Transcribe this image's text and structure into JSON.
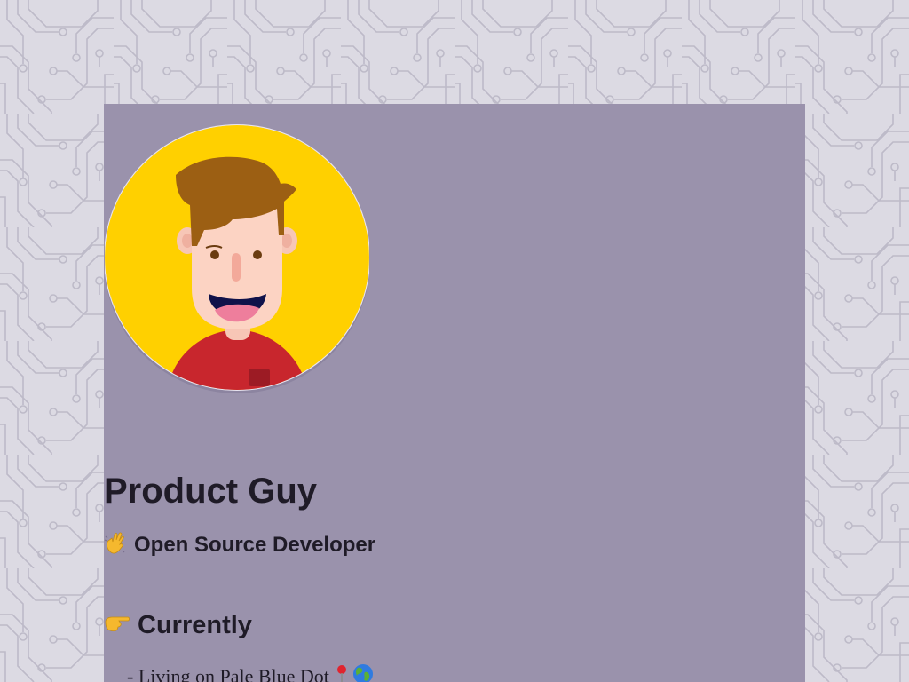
{
  "profile": {
    "name": "Product Guy",
    "tagline_emoji": "wave-icon",
    "tagline": "Open Source Developer"
  },
  "currently": {
    "heading_emoji": "pointing-hand-icon",
    "heading": "Currently",
    "items": [
      {
        "text": "- Living on Pale Blue Dot",
        "icons": [
          "pin-icon",
          "globe-icon"
        ]
      }
    ]
  },
  "colors": {
    "page_background": "#dcdae3",
    "circuit_lines": "#b9b6c4",
    "card_background": "#9a92ac",
    "avatar_background": "#ffd000",
    "text": "#1f1b27"
  }
}
